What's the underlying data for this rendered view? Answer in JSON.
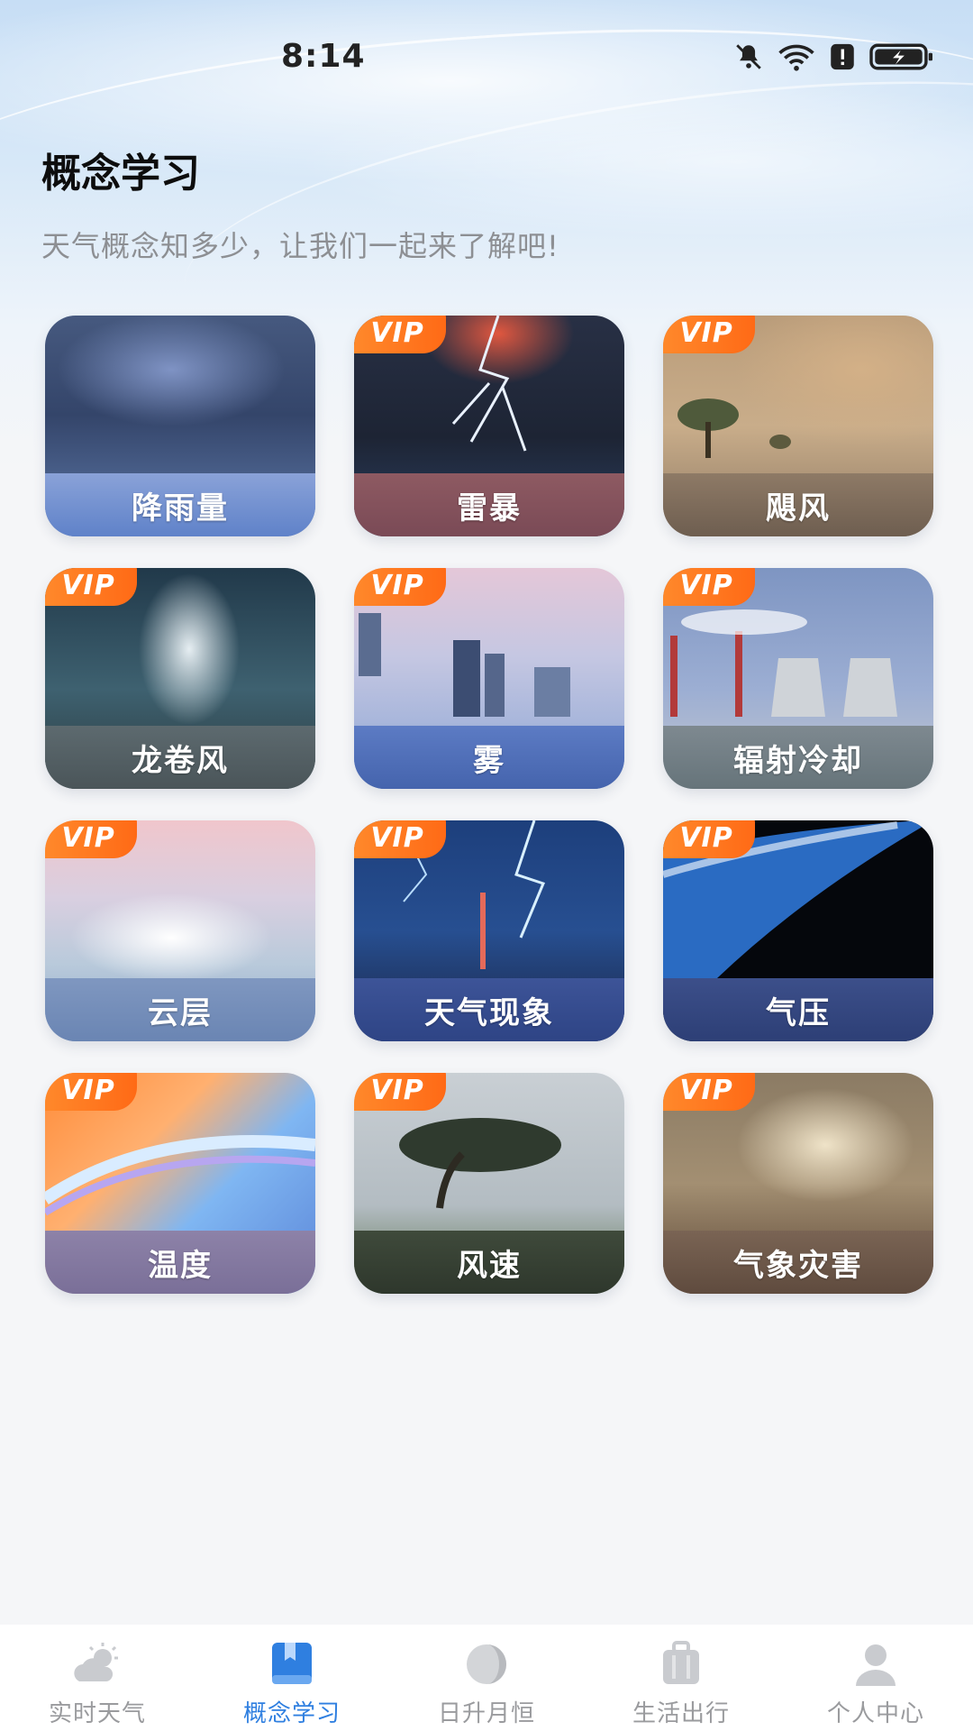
{
  "status_bar": {
    "time": "8:14"
  },
  "header": {
    "title": "概念学习",
    "subtitle": "天气概念知多少，让我们一起来了解吧!"
  },
  "vip_badge": "VIP",
  "cards": [
    {
      "label": "降雨量",
      "vip": false
    },
    {
      "label": "雷暴",
      "vip": true
    },
    {
      "label": "飓风",
      "vip": true
    },
    {
      "label": "龙卷风",
      "vip": true
    },
    {
      "label": "雾",
      "vip": true
    },
    {
      "label": "辐射冷却",
      "vip": true
    },
    {
      "label": "云层",
      "vip": true
    },
    {
      "label": "天气现象",
      "vip": true
    },
    {
      "label": "气压",
      "vip": true
    },
    {
      "label": "温度",
      "vip": true
    },
    {
      "label": "风速",
      "vip": true
    },
    {
      "label": "气象灾害",
      "vip": true
    }
  ],
  "tabbar": {
    "tabs": [
      {
        "label": "实时天气",
        "icon": "partly-cloudy-icon",
        "active": false
      },
      {
        "label": "概念学习",
        "icon": "book-icon",
        "active": true
      },
      {
        "label": "日升月恒",
        "icon": "moon-phase-icon",
        "active": false
      },
      {
        "label": "生活出行",
        "icon": "luggage-icon",
        "active": false
      },
      {
        "label": "个人中心",
        "icon": "person-icon",
        "active": false
      }
    ]
  },
  "colors": {
    "accent": "#2f7fe0",
    "vip": "#ff7a1f",
    "inactive": "#9a9b9e"
  }
}
